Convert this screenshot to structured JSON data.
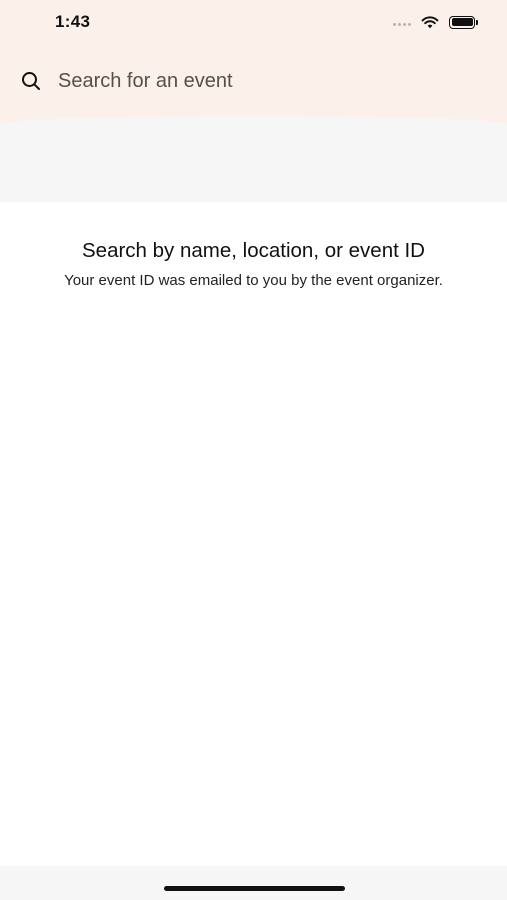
{
  "status_bar": {
    "time": "1:43",
    "icons": [
      "cellular-signal-icon",
      "wifi-icon",
      "battery-icon"
    ]
  },
  "search": {
    "placeholder": "Search for an event",
    "value": "",
    "icon": "search-icon"
  },
  "empty_state": {
    "title": "Search by name, location, or event ID",
    "subtitle": "Your event ID was emailed to you by the event organizer."
  },
  "colors": {
    "header_background": "#fbf1ea",
    "band_background": "#f6f6f6",
    "text_primary": "#111111"
  }
}
